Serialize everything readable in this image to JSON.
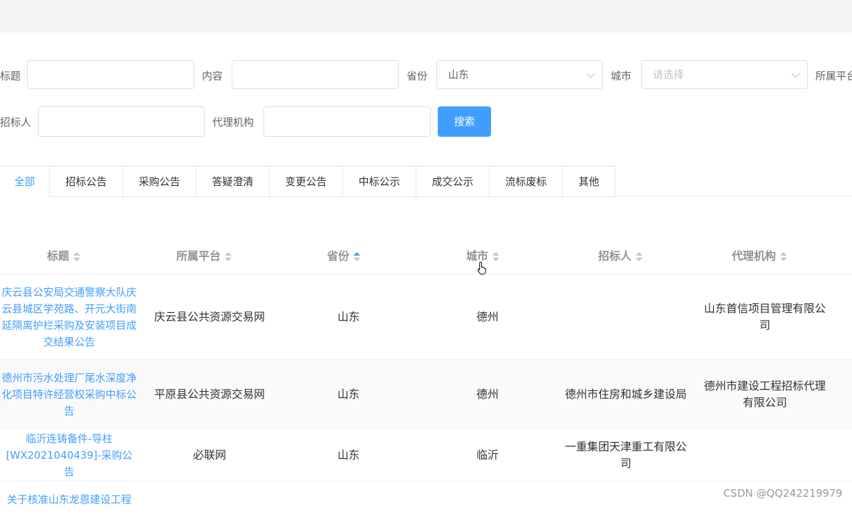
{
  "filters": {
    "title_label": "标题",
    "content_label": "内容",
    "province_label": "省份",
    "province_value": "山东",
    "city_label": "城市",
    "city_placeholder": "请选择",
    "platform_label": "所属平台",
    "bidder_label": "招标人",
    "agency_label": "代理机构",
    "search_button": "搜索"
  },
  "tabs": [
    "全部",
    "招标公告",
    "采购公告",
    "答疑澄清",
    "变更公告",
    "中标公示",
    "成交公示",
    "流标废标",
    "其他"
  ],
  "columns": [
    "标题",
    "所属平台",
    "省份",
    "城市",
    "招标人",
    "代理机构"
  ],
  "sort_active": {
    "column": "省份",
    "direction": "ascending"
  },
  "rows": [
    {
      "title": "庆云县公安局交通警察大队庆云县城区学苑路、开元大街南延隔离护栏采购及安装项目成交结果公告",
      "platform": "庆云县公共资源交易网",
      "province": "山东",
      "city": "德州",
      "bidder": "",
      "agency": "山东首信项目管理有限公司"
    },
    {
      "title": "德州市污水处理厂尾水深度净化项目特许经营权采购中标公告",
      "platform": "平原县公共资源交易网",
      "province": "山东",
      "city": "德州",
      "bidder": "德州市住房和城乡建设局",
      "agency": "德州市建设工程招标代理有限公司"
    },
    {
      "title": "临沂连铸备件-导柱[WX2021040439]-采购公告",
      "platform": "必联网",
      "province": "山东",
      "city": "临沂",
      "bidder": "一重集团天津重工有限公司",
      "agency": ""
    },
    {
      "title": "关于核准山东龙恩建设工程",
      "platform": "",
      "province": "",
      "city": "",
      "bidder": "",
      "agency": ""
    }
  ],
  "watermark": "CSDN @QQ242219979",
  "colors": {
    "primary": "#409eff",
    "border": "#dcdfe6",
    "header_text": "#909399"
  }
}
